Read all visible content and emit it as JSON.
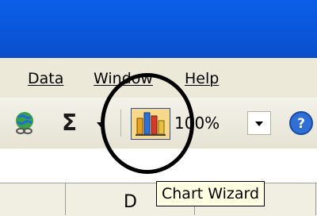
{
  "menu": {
    "items": [
      {
        "label": "Data"
      },
      {
        "label": "Window"
      },
      {
        "label": "Help"
      }
    ]
  },
  "toolbar": {
    "hyperlink_icon": "hyperlink-icon",
    "autosum_label": "Σ",
    "chart_wizard_icon": "chart-wizard-icon",
    "zoom_value": "100%",
    "help_icon": "help-icon"
  },
  "sheet": {
    "column_label": "D"
  },
  "tooltip": {
    "text": "Chart Wizard"
  },
  "colors": {
    "titlebar": "#0a55d8",
    "menubar": "#ece9d8",
    "tooltip_bg": "#ffffe1",
    "highlight": "#f8d88a"
  }
}
